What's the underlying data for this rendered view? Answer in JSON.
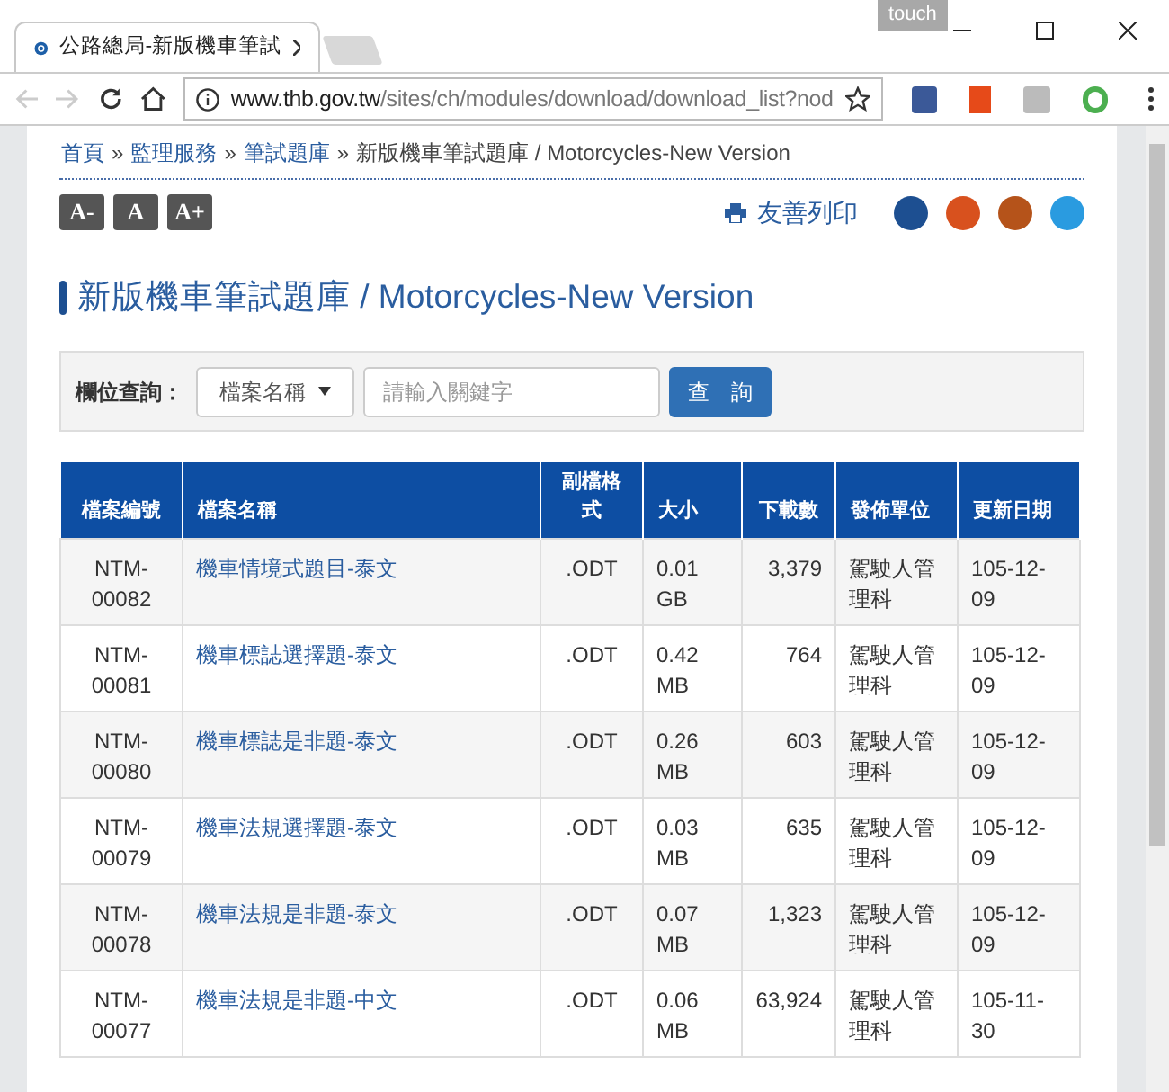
{
  "browser": {
    "tab_title": "公路總局-新版機車筆試",
    "touch_label": "touch",
    "url_host": "www.thb.gov.tw",
    "url_path": "/sites/ch/modules/download/download_list?nod"
  },
  "breadcrumb": [
    {
      "label": "首頁",
      "link": true
    },
    {
      "label": "»",
      "link": false
    },
    {
      "label": "監理服務",
      "link": true
    },
    {
      "label": "»",
      "link": false
    },
    {
      "label": "筆試題庫",
      "link": true
    },
    {
      "label": "»",
      "link": false
    },
    {
      "label": "新版機車筆試題庫 / Motorcycles-New Version",
      "link": false
    }
  ],
  "font_buttons": [
    "A-",
    "A",
    "A+"
  ],
  "print_label": "友善列印",
  "page_title": "新版機車筆試題庫 / Motorcycles-New Version",
  "search": {
    "label": "欄位查詢：",
    "field_select": "檔案名稱",
    "placeholder": "請輸入關鍵字",
    "button": "查　詢"
  },
  "table": {
    "columns": [
      "檔案編號",
      "檔案名稱",
      "副檔格式",
      "大小",
      "下載數",
      "發佈單位",
      "更新日期"
    ],
    "rows": [
      {
        "cells": [
          "NTM-00082",
          "機車情境式題目-泰文",
          ".ODT",
          "0.01 GB",
          "3,379",
          "駕駛人管理科",
          "105-12-09"
        ]
      },
      {
        "cells": [
          "NTM-00081",
          "機車標誌選擇題-泰文",
          ".ODT",
          "0.42 MB",
          "764",
          "駕駛人管理科",
          "105-12-09"
        ]
      },
      {
        "cells": [
          "NTM-00080",
          "機車標誌是非題-泰文",
          ".ODT",
          "0.26 MB",
          "603",
          "駕駛人管理科",
          "105-12-09"
        ]
      },
      {
        "cells": [
          "NTM-00079",
          "機車法規選擇題-泰文",
          ".ODT",
          "0.03 MB",
          "635",
          "駕駛人管理科",
          "105-12-09"
        ]
      },
      {
        "cells": [
          "NTM-00078",
          "機車法規是非題-泰文",
          ".ODT",
          "0.07 MB",
          "1,323",
          "駕駛人管理科",
          "105-12-09"
        ]
      },
      {
        "cells": [
          "NTM-00077",
          "機車法規是非題-中文",
          ".ODT",
          "0.06 MB",
          "63,924",
          "駕駛人管理科",
          "105-11-30"
        ]
      }
    ]
  }
}
